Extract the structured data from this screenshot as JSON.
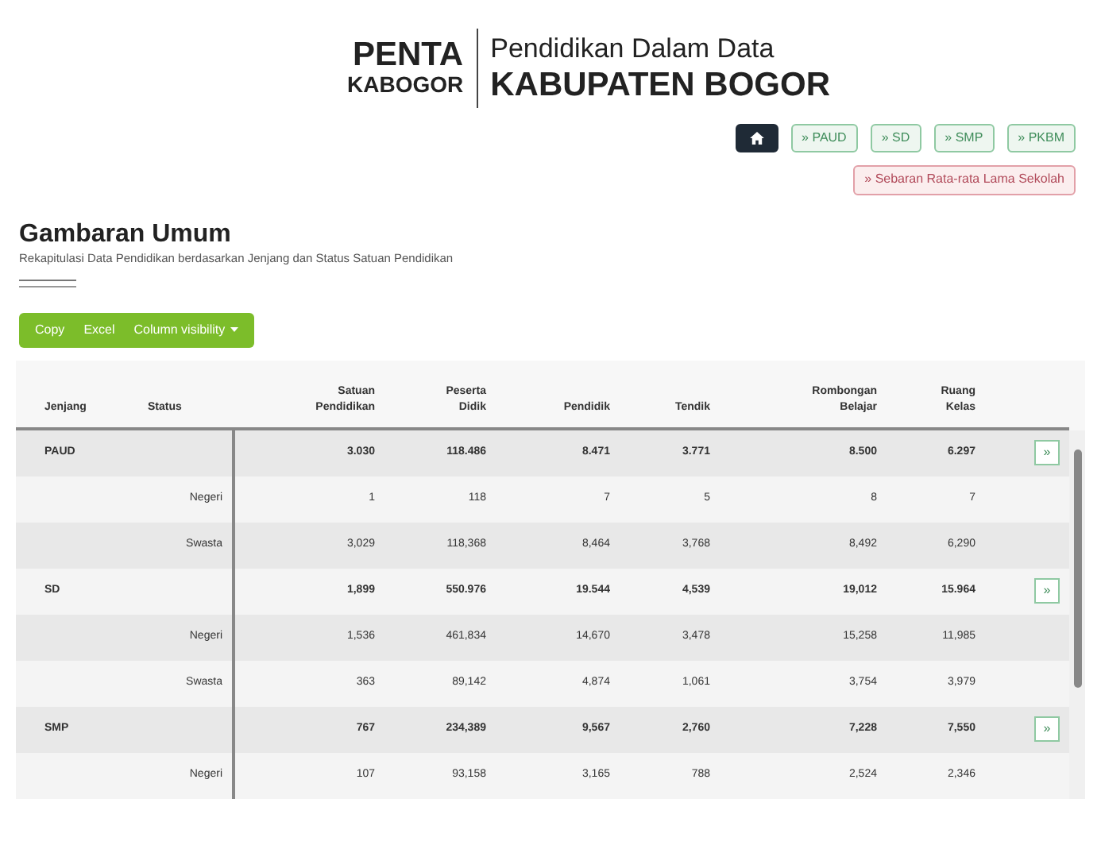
{
  "header": {
    "brand_top": "PENTA",
    "brand_bottom": "KABOGOR",
    "title_top": "Pendidikan Dalam Data",
    "title_bottom": "KABUPATEN BOGOR"
  },
  "nav": [
    {
      "kind": "home",
      "selected": true
    },
    {
      "kind": "link",
      "label": "» PAUD",
      "selected": false
    },
    {
      "kind": "link",
      "label": "» SD",
      "selected": false
    },
    {
      "kind": "link",
      "label": "» SMP",
      "selected": false
    },
    {
      "kind": "link",
      "label": "» PKBM",
      "selected": false
    }
  ],
  "extra_link": "» Sebaran Rata-rata Lama Sekolah",
  "section": {
    "title": "Gambaran Umum",
    "subtitle": "Rekapitulasi Data Pendidikan berdasarkan Jenjang dan Status Satuan Pendidikan"
  },
  "export_buttons": [
    "Copy",
    "Excel",
    "Column visibility"
  ],
  "table": {
    "columns": [
      "Jenjang",
      "Status",
      "Satuan Pendidikan",
      "Peserta Didik",
      "Pendidik",
      "Tendik",
      "Rombongan Belajar",
      "Ruang Kelas"
    ],
    "rows": [
      {
        "kind": "level",
        "cells": [
          "PAUD",
          "",
          "3.030",
          "118.486",
          "8.471",
          "3.771",
          "8.500",
          "6.297"
        ],
        "action": "»"
      },
      {
        "kind": "status",
        "cells": [
          "",
          "Negeri",
          "1",
          "118",
          "7",
          "5",
          "8",
          "7"
        ]
      },
      {
        "kind": "status",
        "cells": [
          "",
          "Swasta",
          "3,029",
          "118,368",
          "8,464",
          "3,768",
          "8,492",
          "6,290"
        ]
      },
      {
        "kind": "level",
        "cells": [
          "SD",
          "",
          "1,899",
          "550.976",
          "19.544",
          "4,539",
          "19,012",
          "15.964"
        ],
        "action": "»"
      },
      {
        "kind": "status",
        "cells": [
          "",
          "Negeri",
          "1,536",
          "461,834",
          "14,670",
          "3,478",
          "15,258",
          "11,985"
        ]
      },
      {
        "kind": "status",
        "cells": [
          "",
          "Swasta",
          "363",
          "89,142",
          "4,874",
          "1,061",
          "3,754",
          "3,979"
        ]
      },
      {
        "kind": "level",
        "cells": [
          "SMP",
          "",
          "767",
          "234,389",
          "9,567",
          "2,760",
          "7,228",
          "7,550"
        ],
        "action": "»"
      },
      {
        "kind": "status",
        "cells": [
          "",
          "Negeri",
          "107",
          "93,158",
          "3,165",
          "788",
          "2,524",
          "2,346"
        ]
      }
    ]
  }
}
